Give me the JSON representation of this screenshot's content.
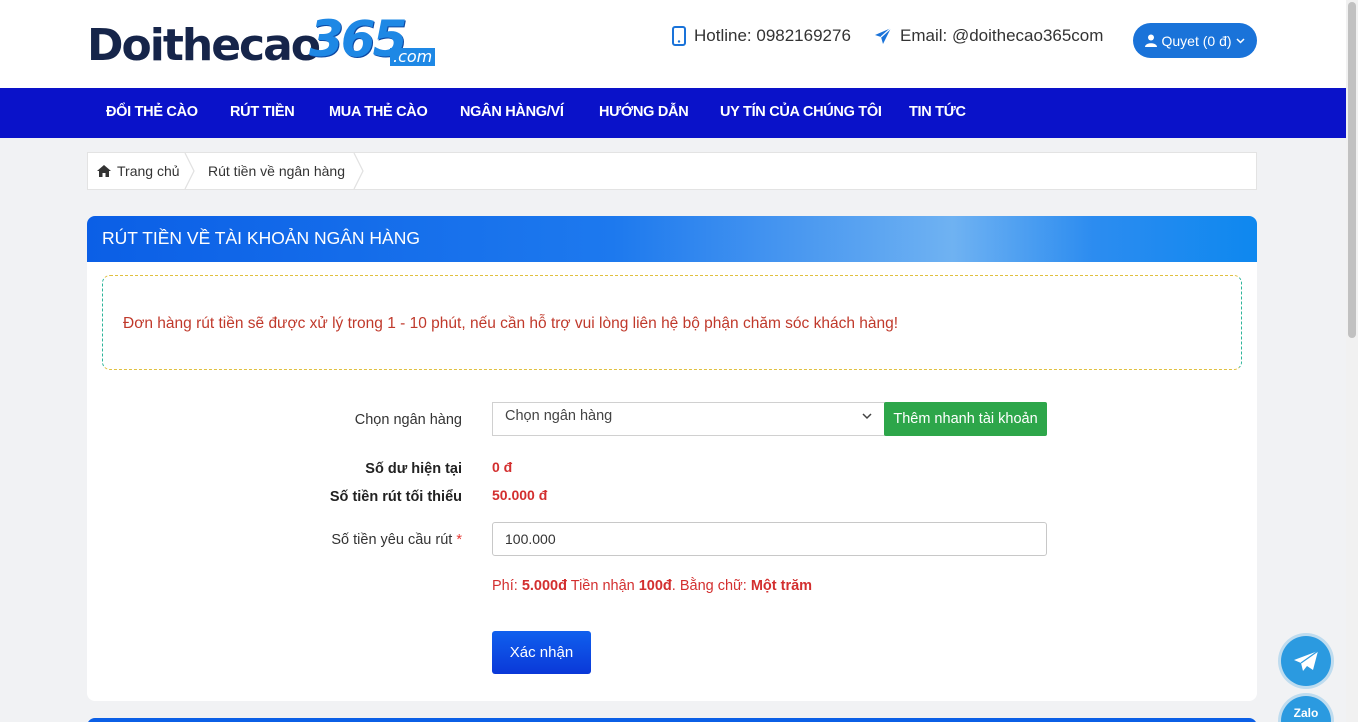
{
  "header": {
    "logo_word": "Doithecao",
    "logo_number": "365",
    "logo_domain": ".com",
    "hotline": "Hotline: 0982169276",
    "email": "Email: @doithecao365com",
    "user_button": "Quyet (0 đ)"
  },
  "nav": [
    {
      "label": "ĐỔI THẺ CÀO"
    },
    {
      "label": "RÚT TIỀN"
    },
    {
      "label": "MUA THẺ CÀO"
    },
    {
      "label": "NGÂN HÀNG/VÍ"
    },
    {
      "label": "HƯỚNG DẪN"
    },
    {
      "label": "UY TÍN CỦA CHÚNG TÔI"
    },
    {
      "label": "TIN TỨC"
    }
  ],
  "breadcrumb": {
    "home": "Trang chủ",
    "current": "Rút tiền về ngân hàng"
  },
  "card": {
    "title": "RÚT TIỀN VỀ TÀI KHOẢN NGÂN HÀNG",
    "notice": "Đơn hàng rút tiền sẽ được xử lý trong 1 - 10 phút, nếu cần hỗ trợ vui lòng liên hệ bộ phận chăm sóc khách hàng!"
  },
  "form": {
    "bank_label": "Chọn ngân hàng",
    "bank_selected": "Chọn ngân hàng",
    "add_account_button": "Thêm nhanh tài khoản",
    "balance_label": "Số dư hiện tại",
    "balance_value": "0 đ",
    "min_label": "Số tiền rút tối thiểu",
    "min_value": "50.000 đ",
    "amount_label": "Số tiền yêu cầu rút",
    "amount_required_mark": "*",
    "amount_value": "100.000",
    "fee_prefix": "Phí: ",
    "fee_value": "5.000đ",
    "receive_prefix": " Tiền nhận ",
    "receive_value": "100đ",
    "words_prefix": ". Bằng chữ: ",
    "words_value": "Một trăm",
    "confirm_button": "Xác nhận"
  },
  "floating": {
    "zalo_label": "Zalo"
  },
  "colors": {
    "nav_bg": "#0a12c9",
    "accent_blue": "#1a73d9",
    "add_button_green": "#2da64a",
    "value_red": "#d32f2f"
  }
}
